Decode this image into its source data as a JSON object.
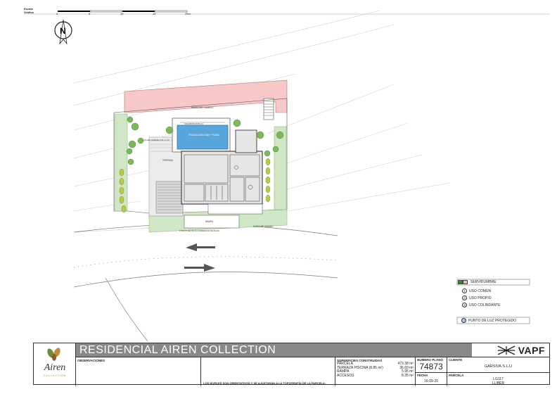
{
  "scale": {
    "label": "Escala Gráfica",
    "ticks": [
      "0",
      "5",
      "10",
      "15",
      "20m"
    ]
  },
  "compass": {
    "letter": "N"
  },
  "plan_labels": {
    "muro_top": "MURO DE CAMINO",
    "pool": "PISCINA 3.80x7.80m\n+ PLAYA",
    "pool_edge": "SOLARIUM (8.85 m²)",
    "terraza": "TERRAZA",
    "rampa": "RAMPA",
    "paso": "1.5/10.5 METROS\nCORREDOR DE AGUA",
    "muro_bottom": "MURO DE CAMINO",
    "plaza": "1 PLAZA GARAJE\n3.00 x 2.70"
  },
  "legend": {
    "servidumbre": "SERVIDUMBRE",
    "uso_items": [
      {
        "n": "1",
        "label": "USO COMÚN"
      },
      {
        "n": "2",
        "label": "USO PROPIO"
      },
      {
        "n": "3",
        "label": "USO COLINDANTE"
      }
    ],
    "luz": "PUNTO DE LUZ PROTEGIDO",
    "colors": {
      "green": "#3a8a3a",
      "pink": "#f0b8b8",
      "light": "#a8c8e8"
    }
  },
  "title_block": {
    "project": "RESIDENCIAL   AIREN COLLECTION",
    "brand": "VAPF",
    "logo_main": "Airen",
    "logo_sub": "COLLECTION",
    "observaciones_label": "OBSERVACIONES",
    "note": "LOS NIVELES SON ORIENTATIVOS Y SE AJUSTARÁN A LA TOPOGRAFÍA DE LA PARCELA.",
    "superficies_label": "SUPERFICIES CONSTRUIDAS",
    "superficies": [
      {
        "name": "PARCELA",
        "value": "473.38 m²"
      },
      {
        "name": "TERRAZA PISCINA (8.85 m²)",
        "value": "36.60 m²"
      },
      {
        "name": "RAMPA",
        "value": "5.95 m²"
      },
      {
        "name": "ACCESOS",
        "value": "8.35 m²"
      }
    ],
    "plano_label": "NUMERO PLANO",
    "plano": "74873",
    "fecha_label": "FECHA",
    "fecha": "16-09-25",
    "cliente_label": "CLIENTE",
    "cliente": "GARSIVA S.L.U",
    "parcela_label": "PARCELA",
    "parcela_1": "LG117",
    "parcela_2": "LLIBER"
  }
}
